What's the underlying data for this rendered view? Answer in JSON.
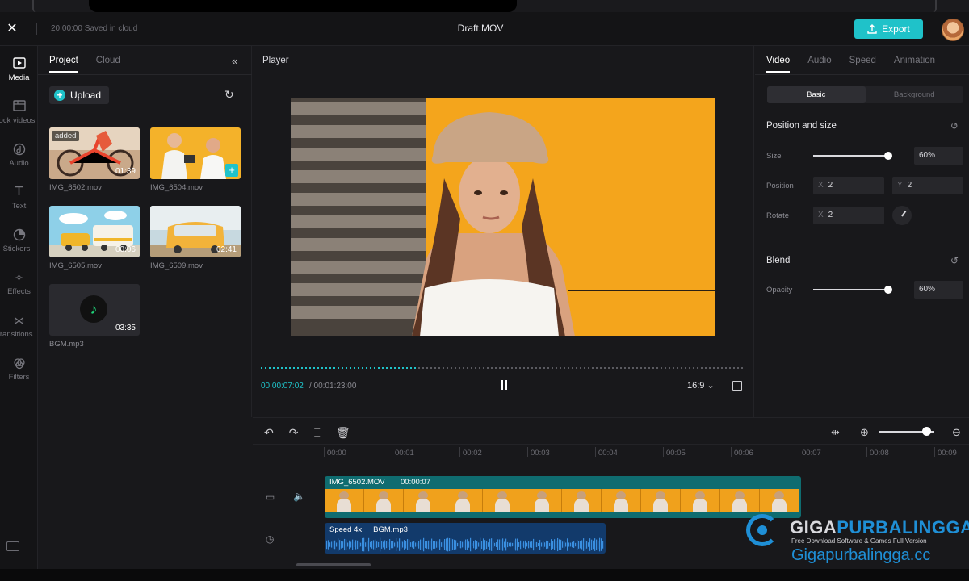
{
  "header": {
    "saved_status": "20:00:00 Saved in cloud",
    "doc_title": "Draft.MOV",
    "export_label": "Export"
  },
  "rail": {
    "items": [
      {
        "label": "Media",
        "icon": "media-icon"
      },
      {
        "label": "Stock videos",
        "icon": "stock-videos-icon"
      },
      {
        "label": "Audio",
        "icon": "audio-icon"
      },
      {
        "label": "Text",
        "icon": "text-icon"
      },
      {
        "label": "Stickers",
        "icon": "stickers-icon"
      },
      {
        "label": "Effects",
        "icon": "effects-icon"
      },
      {
        "label": "Transitions",
        "icon": "transitions-icon"
      },
      {
        "label": "Filters",
        "icon": "filters-icon"
      }
    ]
  },
  "media": {
    "tabs": [
      "Project",
      "Cloud"
    ],
    "upload_label": "Upload",
    "items": [
      {
        "name": "IMG_6502.mov",
        "duration": "01:39",
        "badge": "added"
      },
      {
        "name": "IMG_6504.mov",
        "duration": ""
      },
      {
        "name": "IMG_6505.mov",
        "duration": "00:06"
      },
      {
        "name": "IMG_6509.mov",
        "duration": "02:41"
      },
      {
        "name": "BGM.mp3",
        "duration": "03:35"
      }
    ]
  },
  "player": {
    "title": "Player",
    "current_time": "00:00:07:02",
    "total_time": "/ 00:01:23:00",
    "aspect_ratio": "16:9",
    "progress": 0.32
  },
  "inspector": {
    "tabs": [
      "Video",
      "Audio",
      "Speed",
      "Animation"
    ],
    "segments": [
      "Basic",
      "Background"
    ],
    "position_section": "Position and size",
    "size_label": "Size",
    "size_value": "60%",
    "size_level": 0.97,
    "position_label": "Position",
    "pos_x_axis": "X",
    "pos_x": "2",
    "pos_y_axis": "Y",
    "pos_y": "2",
    "rotate_label": "Rotate",
    "rotate_axis": "X",
    "rotate_value": "2",
    "blend_section": "Blend",
    "opacity_label": "Opacity",
    "opacity_value": "60%",
    "opacity_level": 0.97
  },
  "timeline": {
    "ticks": [
      "00:00",
      "00:01",
      "00:02",
      "00:03",
      "00:04",
      "00:05",
      "00:06",
      "00:07",
      "00:08",
      "00:09"
    ],
    "video_clip": {
      "name": "IMG_6502.MOV",
      "duration": "00:00:07"
    },
    "audio_clip": {
      "speed": "Speed 4x",
      "name": "BGM.mp3"
    },
    "zoom_level": 0.85
  },
  "watermark": {
    "brand_main": "GIGA",
    "brand_accent": "PURBALINGGA",
    "subtitle": "Free Download Software & Games Full Version",
    "url": "Gigapurbalingga.cc"
  },
  "colors": {
    "accent": "#1fc2c9",
    "background": "#18181b",
    "video_clip": "#0f6c70",
    "audio_clip": "#123a6b"
  }
}
